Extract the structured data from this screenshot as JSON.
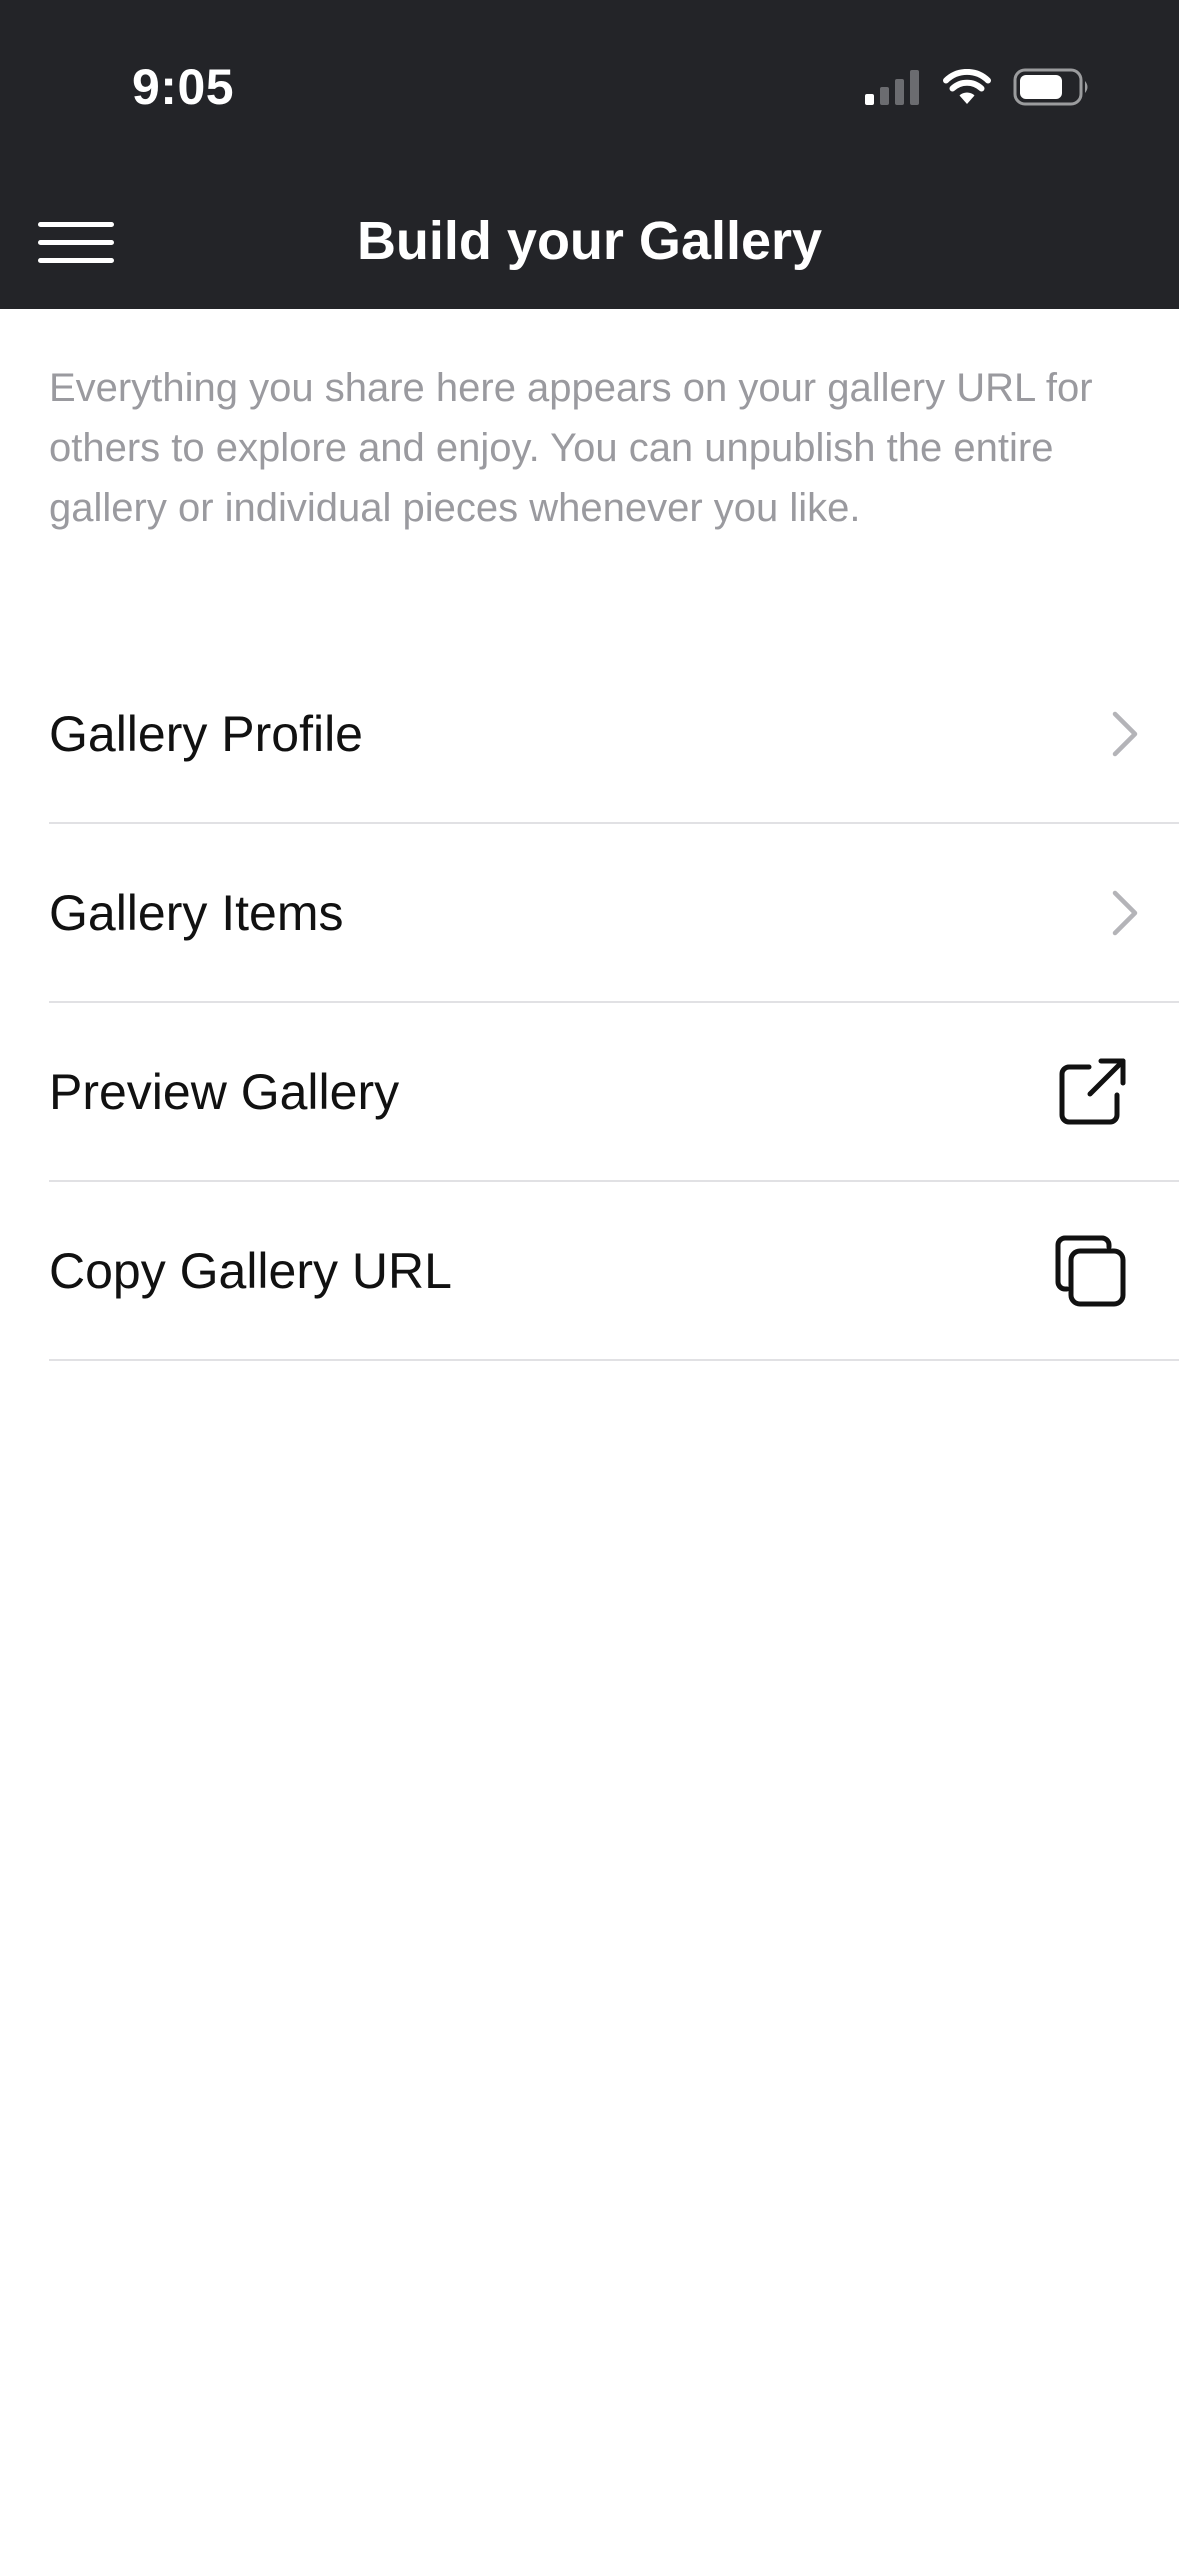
{
  "status_bar": {
    "time": "9:05",
    "icons": [
      "cellular-signal-icon",
      "wifi-icon",
      "battery-icon"
    ]
  },
  "nav": {
    "title": "Build your Gallery",
    "menu_icon": "hamburger-menu-icon"
  },
  "description": "Everything you share here appears on your gallery URL for others to explore and enjoy. You can unpublish the entire gallery or individual pieces whenever you like.",
  "menu_items": [
    {
      "label": "Gallery Profile",
      "icon": "chevron-right-icon"
    },
    {
      "label": "Gallery Items",
      "icon": "chevron-right-icon"
    },
    {
      "label": "Preview Gallery",
      "icon": "external-link-icon"
    },
    {
      "label": "Copy Gallery URL",
      "icon": "copy-icon"
    }
  ],
  "colors": {
    "header_bg": "#232428",
    "header_text": "#ffffff",
    "description_text": "#9a9a9f",
    "row_text": "#111111",
    "divider": "#e1e1e4",
    "chevron": "#b4b4b8"
  }
}
